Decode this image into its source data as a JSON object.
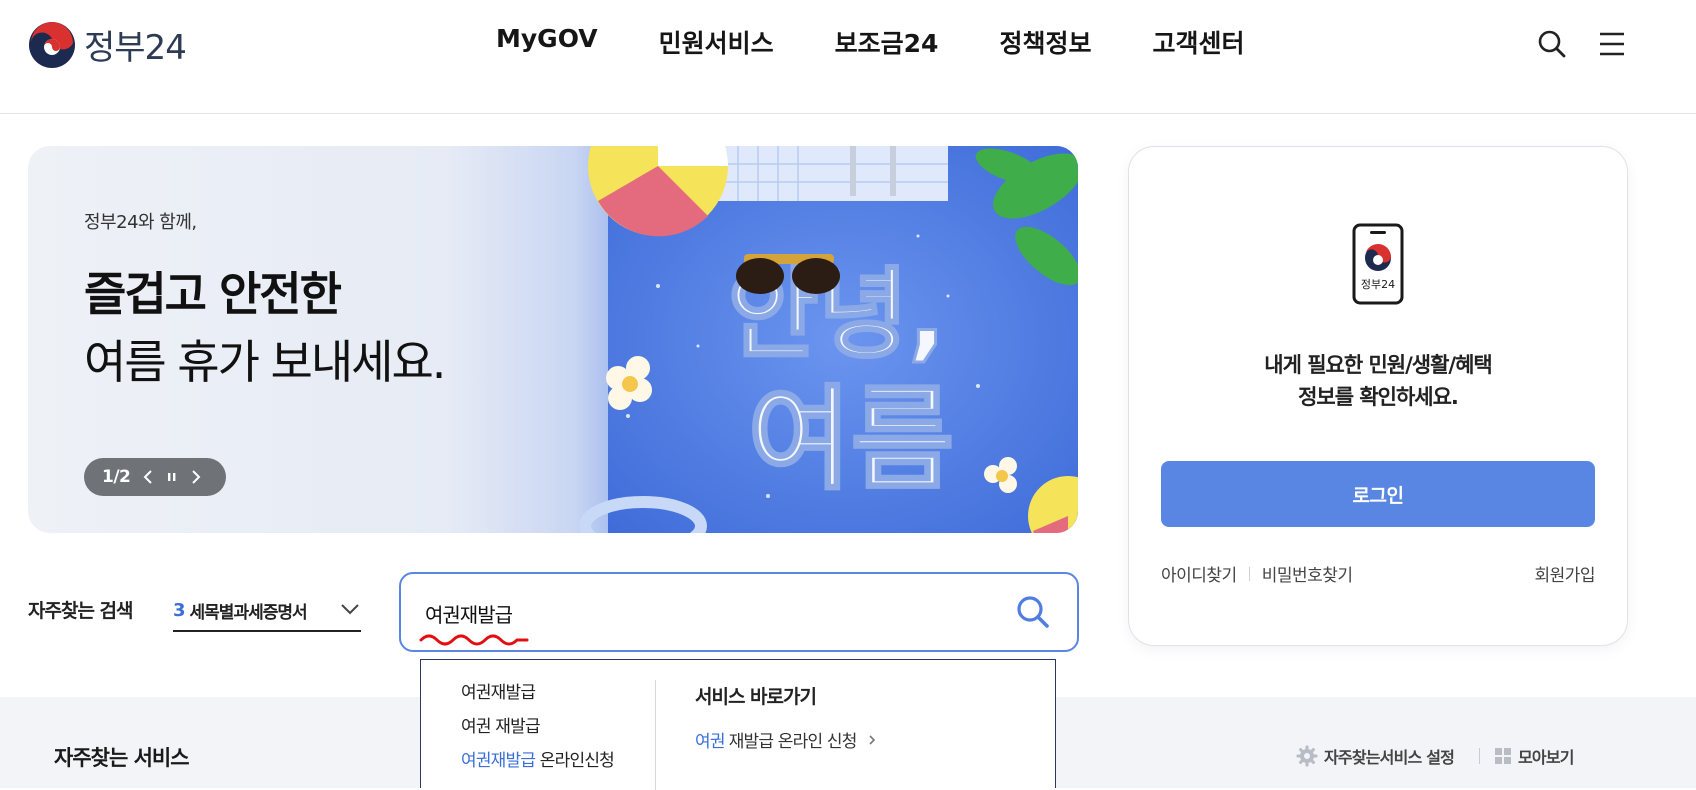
{
  "header": {
    "logo_text": "정부24",
    "nav": [
      "MyGOV",
      "민원서비스",
      "보조금24",
      "정책정보",
      "고객센터"
    ],
    "icons": [
      "search-icon",
      "menu-icon"
    ]
  },
  "banner": {
    "small_text": "정부24와 함께,",
    "title_line1": "즐겁고 안전한",
    "title_line2": "여름 휴가 보내세요.",
    "counter": "1/2",
    "art_text_line1": "안녕,",
    "art_text_line2": "여름"
  },
  "login": {
    "logo_text": "정부24",
    "message_line1": "내게 필요한 민원/생활/혜택",
    "message_line2": "정보를 확인하세요.",
    "login_button": "로그인",
    "find_id": "아이디찾기",
    "find_password": "비밀번호찾기",
    "signup": "회원가입"
  },
  "frequent_search": {
    "label": "자주찾는 검색",
    "selected_rank": "3",
    "selected_text": "세목별과세증명서"
  },
  "search": {
    "value": "여권재발급"
  },
  "autocomplete": {
    "items": [
      {
        "highlight": "",
        "text": "여권재발급"
      },
      {
        "highlight": "",
        "text": "여권 재발급"
      },
      {
        "highlight": "여권재발급",
        "text": " 온라인신청"
      }
    ],
    "heading": "서비스 바로가기",
    "shortcut_highlight": "여권",
    "shortcut_text": "재발급 온라인 신청"
  },
  "services": {
    "title": "자주찾는 서비스",
    "settings_label": "자주찾는서비스 설정",
    "collect_label": "모아보기"
  },
  "colors": {
    "accent": "#5a86e3",
    "highlight": "#3a6fd8",
    "nav_text": "#161616"
  }
}
